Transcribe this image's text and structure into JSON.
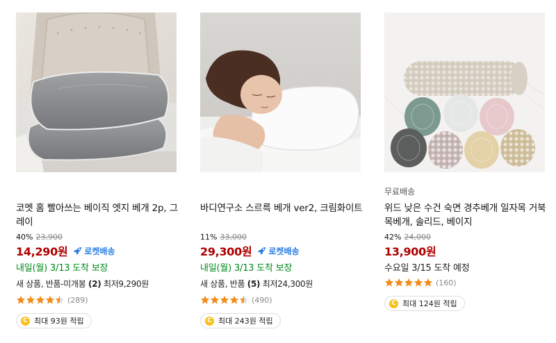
{
  "products": [
    {
      "name": "코멧 홈 빨아쓰는 베이직 엣지 베개 2p, 그레이",
      "delivery_tag": "",
      "discount": "40%",
      "base_price": "23,900",
      "price": "14,290원",
      "rocket_label": "로켓배송",
      "arrival": "내일(월) 3/13 도착 보장",
      "offers_prefix": "새 상품, 반품-미개봉",
      "offers_count": "(2)",
      "offers_suffix": "최저9,290원",
      "rating": 4.5,
      "review_count": "(289)",
      "reward": "최대 93원 적립"
    },
    {
      "name": "바디연구소 스르륵 베개 ver2, 크림화이트",
      "delivery_tag": "",
      "discount": "11%",
      "base_price": "33,000",
      "price": "29,300원",
      "rocket_label": "로켓배송",
      "arrival": "내일(월) 3/13 도착 보장",
      "offers_prefix": "새 상품, 반품",
      "offers_count": "(5)",
      "offers_suffix": "최저24,300원",
      "rating": 4.5,
      "review_count": "(490)",
      "reward": "최대 243원 적립"
    },
    {
      "name": "위드 낮은 수건 숙면 경추베개 일자목 거북목베개, 솔리드, 베이지",
      "delivery_tag": "무료배송",
      "discount": "42%",
      "base_price": "24,000",
      "price": "13,900원",
      "rocket_label": "",
      "arrival": "수요일 3/15 도착 예정",
      "offers_prefix": "",
      "offers_count": "",
      "offers_suffix": "",
      "rating": 5,
      "review_count": "(160)",
      "reward": "최대 124원 적립"
    }
  ],
  "coin_glyph": "C",
  "colors": {
    "price": "#ae0000",
    "rocket": "#2a7de1",
    "arrival": "#00891a",
    "star": "#f28c1c"
  }
}
